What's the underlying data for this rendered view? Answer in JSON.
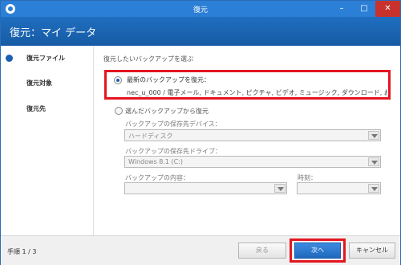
{
  "window": {
    "title": "復元",
    "min_glyph": "–",
    "max_glyph": "□",
    "close_glyph": "✕"
  },
  "header": {
    "title": "復元：マイ データ"
  },
  "sidebar": {
    "items": [
      {
        "label": "復元ファイル",
        "active": true
      },
      {
        "label": "復元対象",
        "active": false
      },
      {
        "label": "復元先",
        "active": false
      }
    ]
  },
  "main": {
    "section_label": "復元したいバックアップを選ぶ",
    "option_latest": {
      "title": "最新のバックアップを復元：",
      "detail": "nec_u_000 / 電子メール, ドキュメント, ピクチャ, ビデオ, ミュージック, ダウンロード, お気に入り, I... - ロ...",
      "selected": true
    },
    "option_chosen": {
      "title": "選んだバックアップから復元",
      "selected": false
    },
    "fields": {
      "device_label": "バックアップの保存先デバイス：",
      "device_value": "ハードディスク",
      "drive_label": "バックアップの保存先ドライブ：",
      "drive_value": "Windows 8.1 (C:)",
      "content_label": "バックアップの内容：",
      "content_value": "",
      "time_label": "時刻：",
      "time_value": ""
    }
  },
  "footer": {
    "step": "手順 1 / 3",
    "back_label": "戻る",
    "next_label": "次へ",
    "cancel_label": "キャンセル"
  },
  "colors": {
    "title_bar": "#2c7fd6",
    "header": "#1b63b4",
    "highlight": "#e41620",
    "accent": "#2069bd"
  }
}
